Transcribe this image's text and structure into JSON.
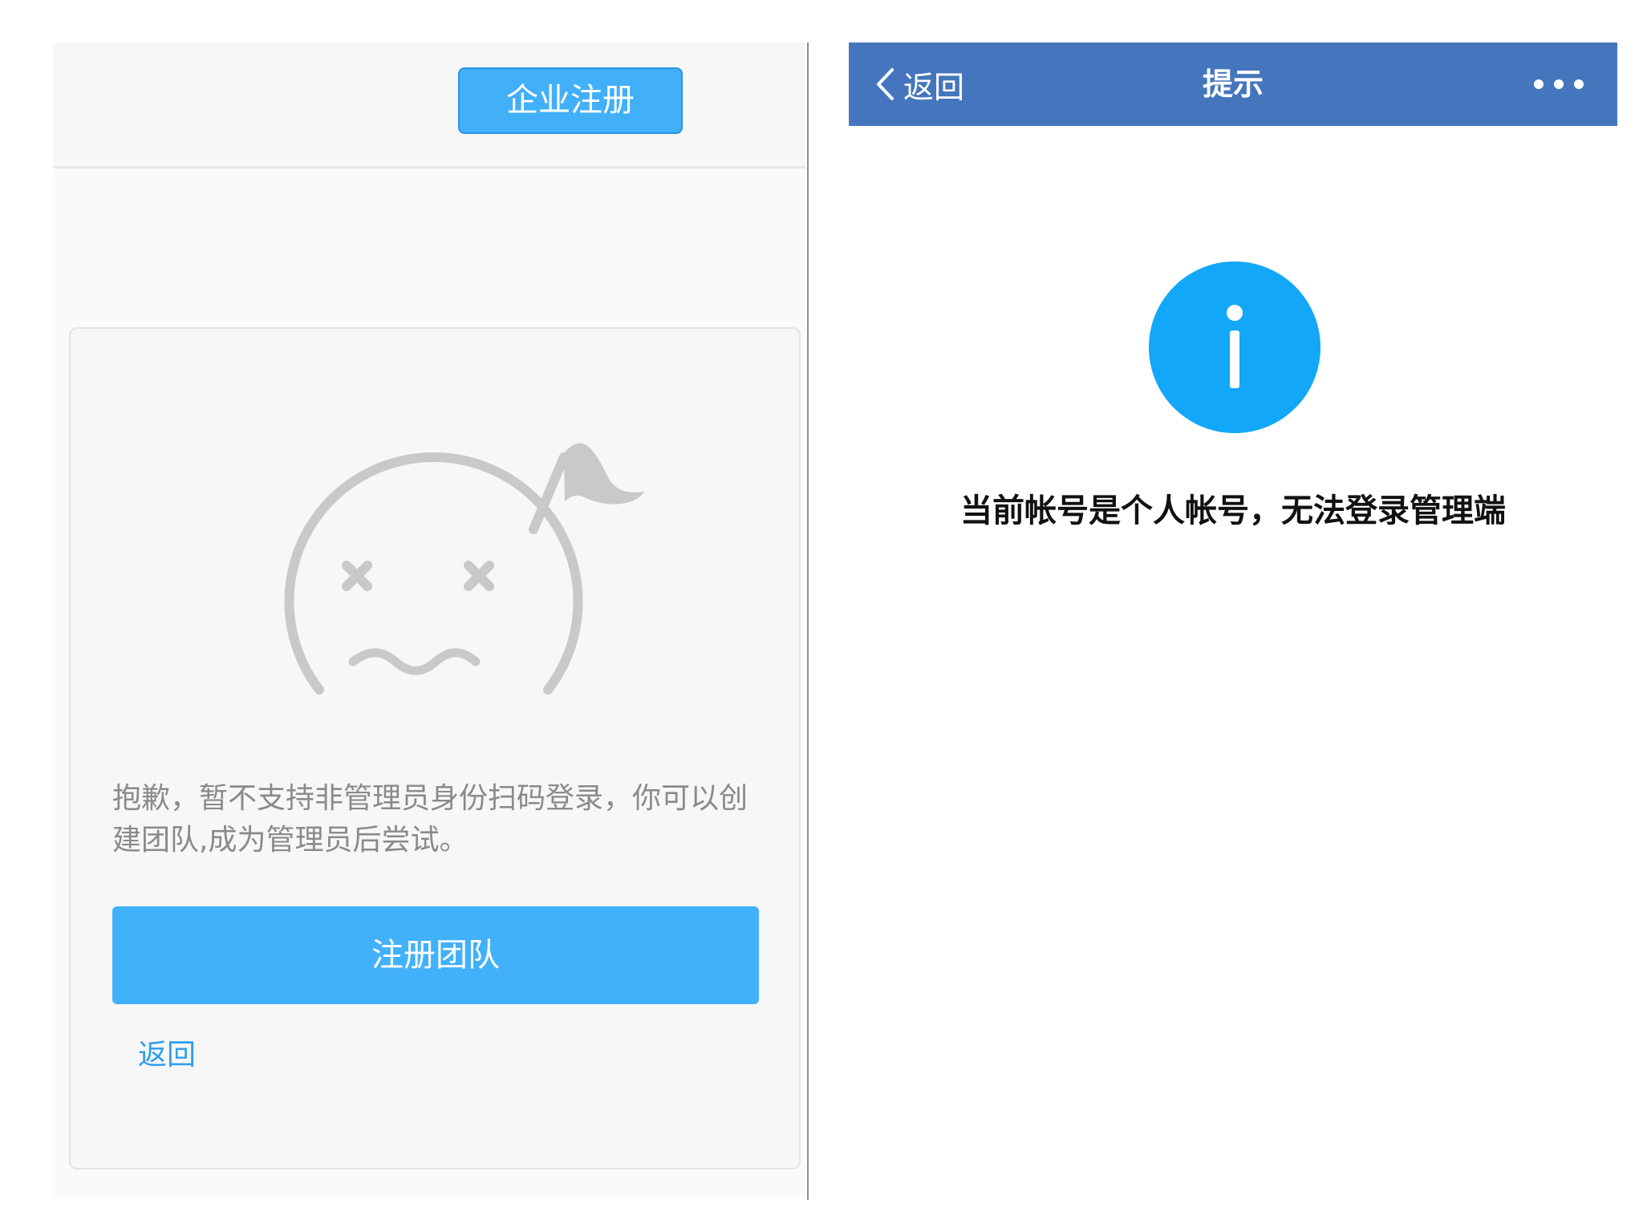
{
  "left": {
    "enterprise_register_label": "企业注册",
    "message": "抱歉，暂不支持非管理员身份扫码登录，你可以创建团队,成为管理员后尝试。",
    "register_team_label": "注册团队",
    "back_label": "返回"
  },
  "right": {
    "nav": {
      "back_label": "返回",
      "title": "提示"
    },
    "message": "当前帐号是个人帐号，无法登录管理端"
  },
  "colors": {
    "primary_blue": "#42b1fb",
    "navbar_blue": "#4576bd",
    "info_blue": "#12a7f8",
    "face_gray": "#c9c9c9"
  },
  "icons": [
    "sad-face-illustration",
    "chevron-left-icon",
    "more-dots-icon",
    "info-icon"
  ]
}
